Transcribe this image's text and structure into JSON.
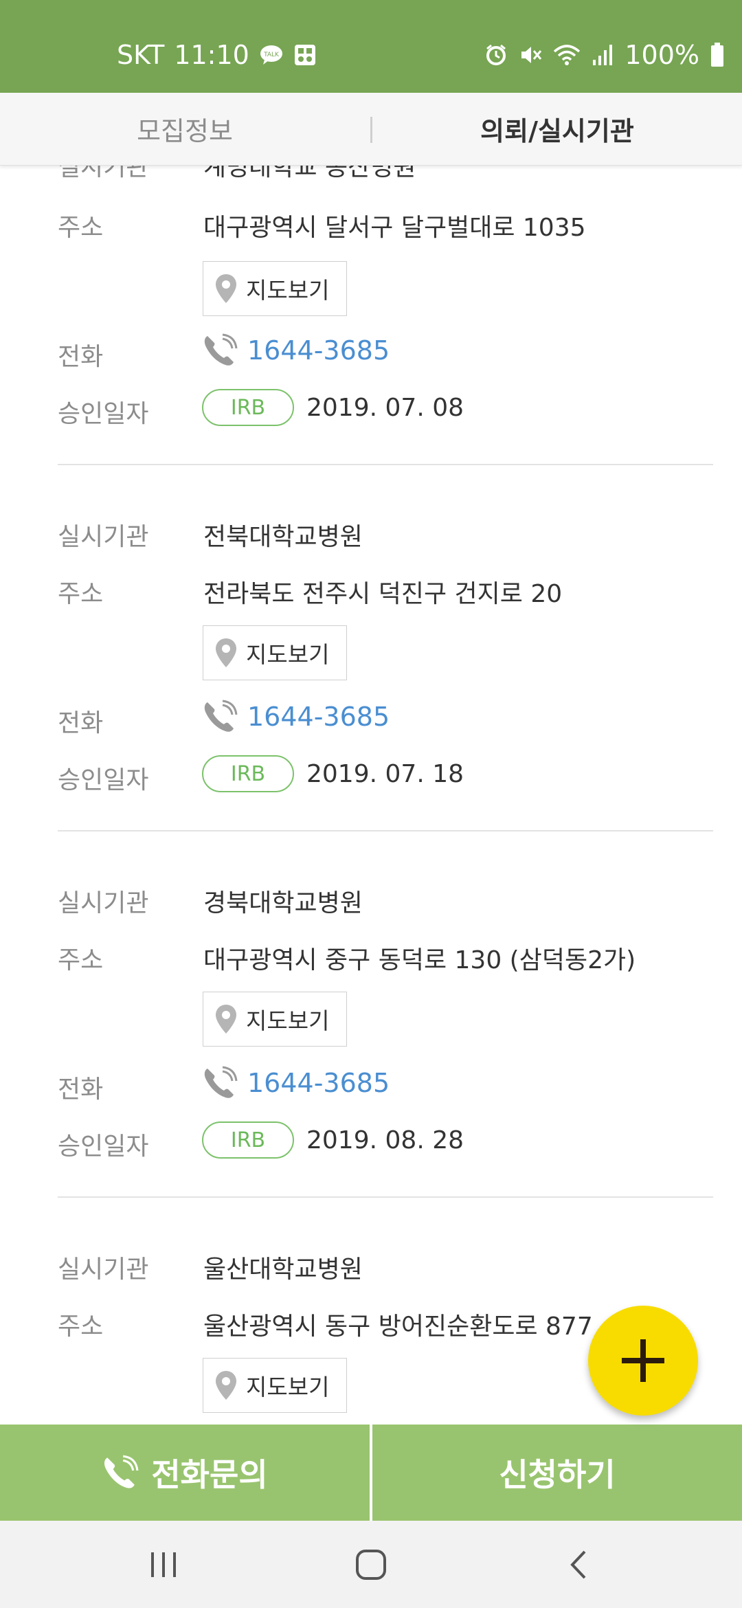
{
  "status_bar": {
    "carrier": "SKT",
    "time": "11:10",
    "battery": "100%",
    "icons": [
      "talk-icon",
      "gallery-icon",
      "alarm-icon",
      "mute-icon",
      "wifi-icon",
      "signal-icon",
      "battery-icon"
    ]
  },
  "tabs": [
    {
      "label": "모집정보",
      "selected": false
    },
    {
      "label": "의뢰/실시기관",
      "selected": true
    }
  ],
  "labels": {
    "institution": "실시기관",
    "address": "주소",
    "phone": "전화",
    "approval_date": "승인일자",
    "map_button": "지도보기",
    "irb": "IRB"
  },
  "institutions": [
    {
      "name": "계명대학교 동산병원",
      "address": "대구광역시 달서구 달구벌대로 1035",
      "phone": "1644-3685",
      "approval_date": "2019. 07. 08"
    },
    {
      "name": "전북대학교병원",
      "address": "전라북도 전주시 덕진구 건지로 20",
      "phone": "1644-3685",
      "approval_date": "2019. 07. 18"
    },
    {
      "name": "경북대학교병원",
      "address": "대구광역시 중구 동덕로 130 (삼덕동2가)",
      "phone": "1644-3685",
      "approval_date": "2019. 08. 28"
    },
    {
      "name": "울산대학교병원",
      "address": "울산광역시 동구 방어진순환도로 877",
      "phone": "",
      "approval_date": ""
    }
  ],
  "actions": {
    "call": "전화문의",
    "apply": "신청하기"
  },
  "colors": {
    "status_bar": "#77a553",
    "action_bar": "#99c46f",
    "phone_link": "#4a8ed1",
    "irb_badge": "#7cc26b",
    "fab": "#f8dc00"
  }
}
